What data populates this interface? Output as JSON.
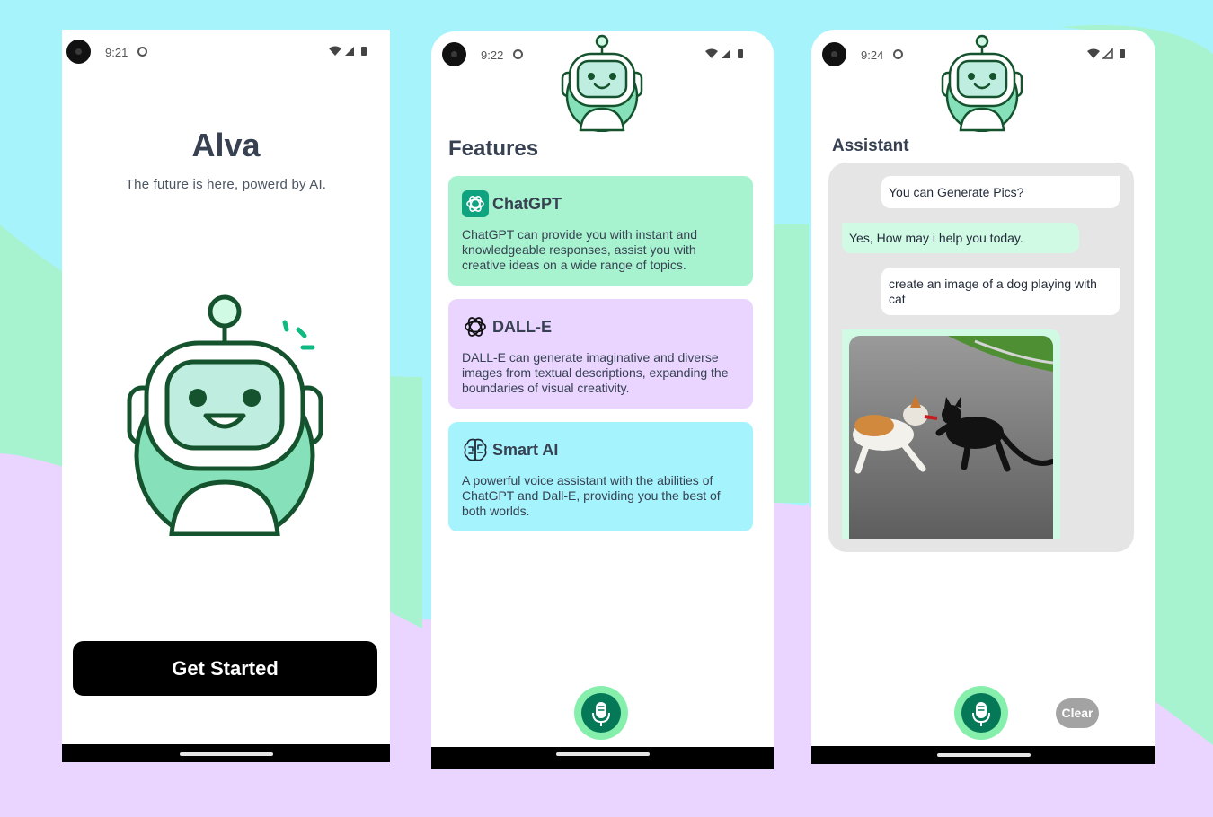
{
  "screens": [
    {
      "time": "9:21",
      "app_title": "Alva",
      "tagline": "The future is here, powerd by AI.",
      "cta_label": "Get Started"
    },
    {
      "time": "9:22",
      "title": "Features",
      "features": [
        {
          "name": "ChatGPT",
          "icon": "chatgpt-logo-icon",
          "color": "#a7f3d0",
          "description": "ChatGPT can provide you with instant and knowledgeable responses, assist you with creative ideas on a wide range of topics."
        },
        {
          "name": "DALL-E",
          "icon": "openai-logo-icon",
          "color": "#e9d5ff",
          "description": "DALL-E can generate imaginative and diverse images from textual descriptions, expanding the boundaries of visual creativity."
        },
        {
          "name": "Smart AI",
          "icon": "brain-icon",
          "color": "#a5f3fc",
          "description": "A powerful voice assistant with the abilities of ChatGPT and Dall-E, providing you the best of both worlds."
        }
      ]
    },
    {
      "time": "9:24",
      "title": "Assistant",
      "messages": [
        {
          "role": "user",
          "text": "You can Generate Pics?"
        },
        {
          "role": "assistant",
          "text": "Yes, How may i help you today."
        },
        {
          "role": "user",
          "text": "create an image of a dog playing with cat"
        },
        {
          "role": "assistant",
          "type": "image",
          "image": "generated-dog-and-cat-image"
        }
      ],
      "clear_label": "Clear"
    }
  ],
  "colors": {
    "accent_green": "#047857",
    "mic_ring": "#86efac",
    "background_cyan": "#a7f3fb",
    "background_mint": "#a7f3d0",
    "background_lavender": "#e9d5ff"
  }
}
